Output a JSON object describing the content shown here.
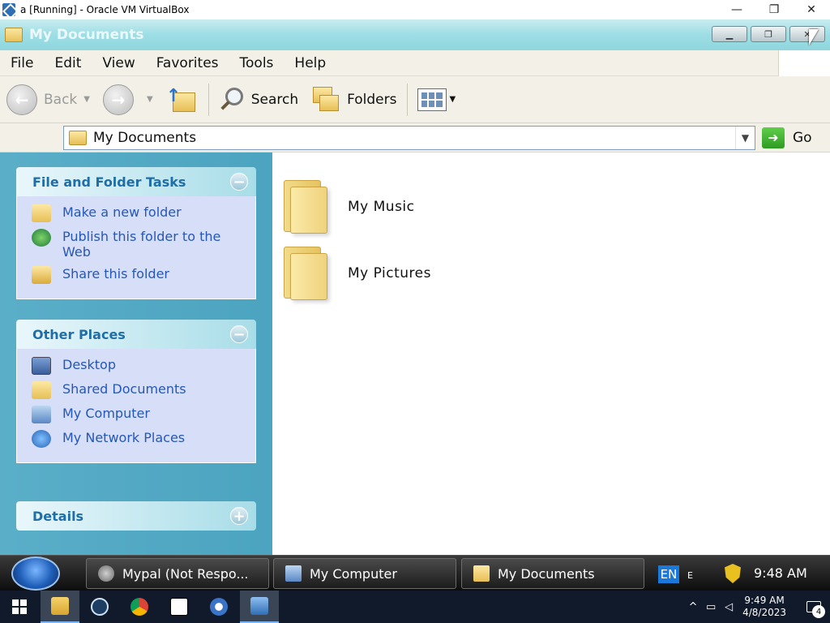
{
  "host": {
    "title": "a [Running] - Oracle VM VirtualBox",
    "controls": {
      "minimize": "—",
      "maximize": "❐",
      "close": "✕"
    }
  },
  "window": {
    "title": "My Documents",
    "buttons": {
      "minimize": "▁",
      "restore": "❐",
      "close": "✕"
    }
  },
  "menu": [
    "File",
    "Edit",
    "View",
    "Favorites",
    "Tools",
    "Help"
  ],
  "toolbar": {
    "back": "Back",
    "search": "Search",
    "folders": "Folders"
  },
  "address": {
    "value": "My Documents",
    "go": "Go"
  },
  "taskpane": {
    "file_tasks": {
      "title": "File and Folder Tasks",
      "items": [
        "Make a new folder",
        "Publish this folder to the Web",
        "Share this folder"
      ]
    },
    "other_places": {
      "title": "Other Places",
      "items": [
        "Desktop",
        "Shared Documents",
        "My Computer",
        "My Network Places"
      ]
    },
    "details": {
      "title": "Details"
    }
  },
  "content": {
    "folders": [
      "My Music",
      "My Pictures"
    ]
  },
  "xp_taskbar": {
    "tasks": [
      "Mypal (Not Respo...",
      "My Computer",
      "My Documents"
    ],
    "lang": "EN",
    "lang_sub": "E",
    "clock": "9:48 AM"
  },
  "host_taskbar": {
    "time": "9:49 AM",
    "date": "4/8/2023",
    "notifications": "4"
  },
  "colors": {
    "task_pane_bg": "#4ba4c0",
    "task_link": "#2757b5",
    "pane_header_text": "#1f6ea8"
  }
}
